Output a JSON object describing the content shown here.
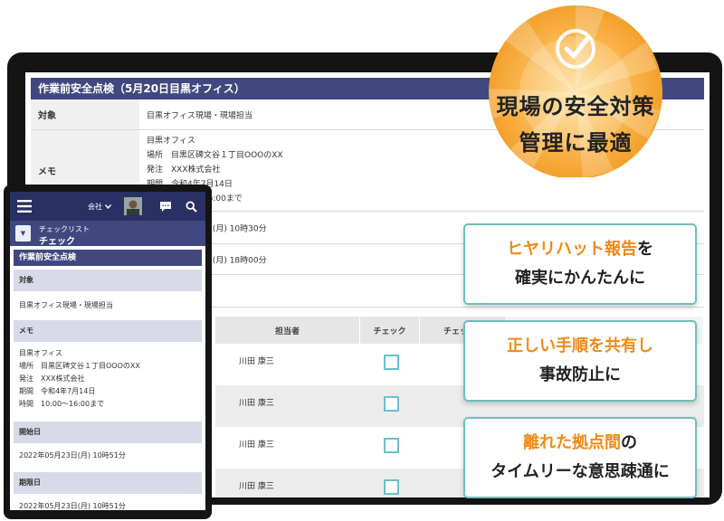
{
  "desktop": {
    "header_title": "作業前安全点検（5月20日目黒オフィス）",
    "rows": [
      {
        "label": "対象",
        "value": "目黒オフィス現場・現場担当"
      },
      {
        "label": "メモ",
        "memo": [
          "目黒オフィス",
          "場所　目黒区碑文谷１丁目OOOのXX",
          "発注　XXX株式会社",
          "期間　令和4年7月14日",
          "時間　10:00〜16:00まで"
        ]
      },
      {
        "label": "",
        "value": "2022年05月23日(月) 10時30分"
      },
      {
        "label": "",
        "value": "2022年05月23日(月) 18時00分"
      }
    ],
    "table_headers": [
      "担当者",
      "チェック",
      "チェック日"
    ],
    "table_rows": [
      {
        "name": "川田 康三",
        "checked": false
      },
      {
        "name": "川田 康三",
        "checked": false
      },
      {
        "name": "川田 康三",
        "checked": false
      },
      {
        "name": "川田 康三",
        "checked": false
      }
    ]
  },
  "phone": {
    "company_label": "会社",
    "subheader_small": "チェックリスト",
    "subheader_big": "チェック",
    "title": "作業前安全点検",
    "sections": [
      {
        "label": "対象",
        "value": "目黒オフィス現場・現場担当"
      },
      {
        "label": "メモ",
        "memo": [
          "目黒オフィス",
          "場所　目黒区碑文谷１丁目OOOのXX",
          "発注　XXX株式会社",
          "期間　令和4年7月14日",
          "時間　10:00〜16:00まで"
        ]
      },
      {
        "label": "開始日",
        "value": "2022年05月23日(月) 10時51分"
      },
      {
        "label": "期限日",
        "value": "2022年05月23日(月) 10時51分"
      }
    ]
  },
  "badge": {
    "line1": "現場の安全対策",
    "line2": "管理に最適"
  },
  "cards": [
    {
      "line1_accent": "ヒヤリハット報告",
      "line1_rest": "を",
      "line2_accent": "",
      "line2_rest": "確実にかんたんに"
    },
    {
      "line1_accent": "正しい手順を共有し",
      "line1_rest": "",
      "line2_accent": "",
      "line2_rest": "事故防止に"
    },
    {
      "line1_accent": "離れた拠点間",
      "line1_rest": "の",
      "line2_accent": "",
      "line2_rest": "タイムリーな意思疎通に"
    }
  ],
  "colors": {
    "navy": "#40487f",
    "nav_dark": "#283064",
    "accent_orange": "#f08a16",
    "card_border": "#6fbfb8",
    "checkbox": "#69c0cc"
  }
}
